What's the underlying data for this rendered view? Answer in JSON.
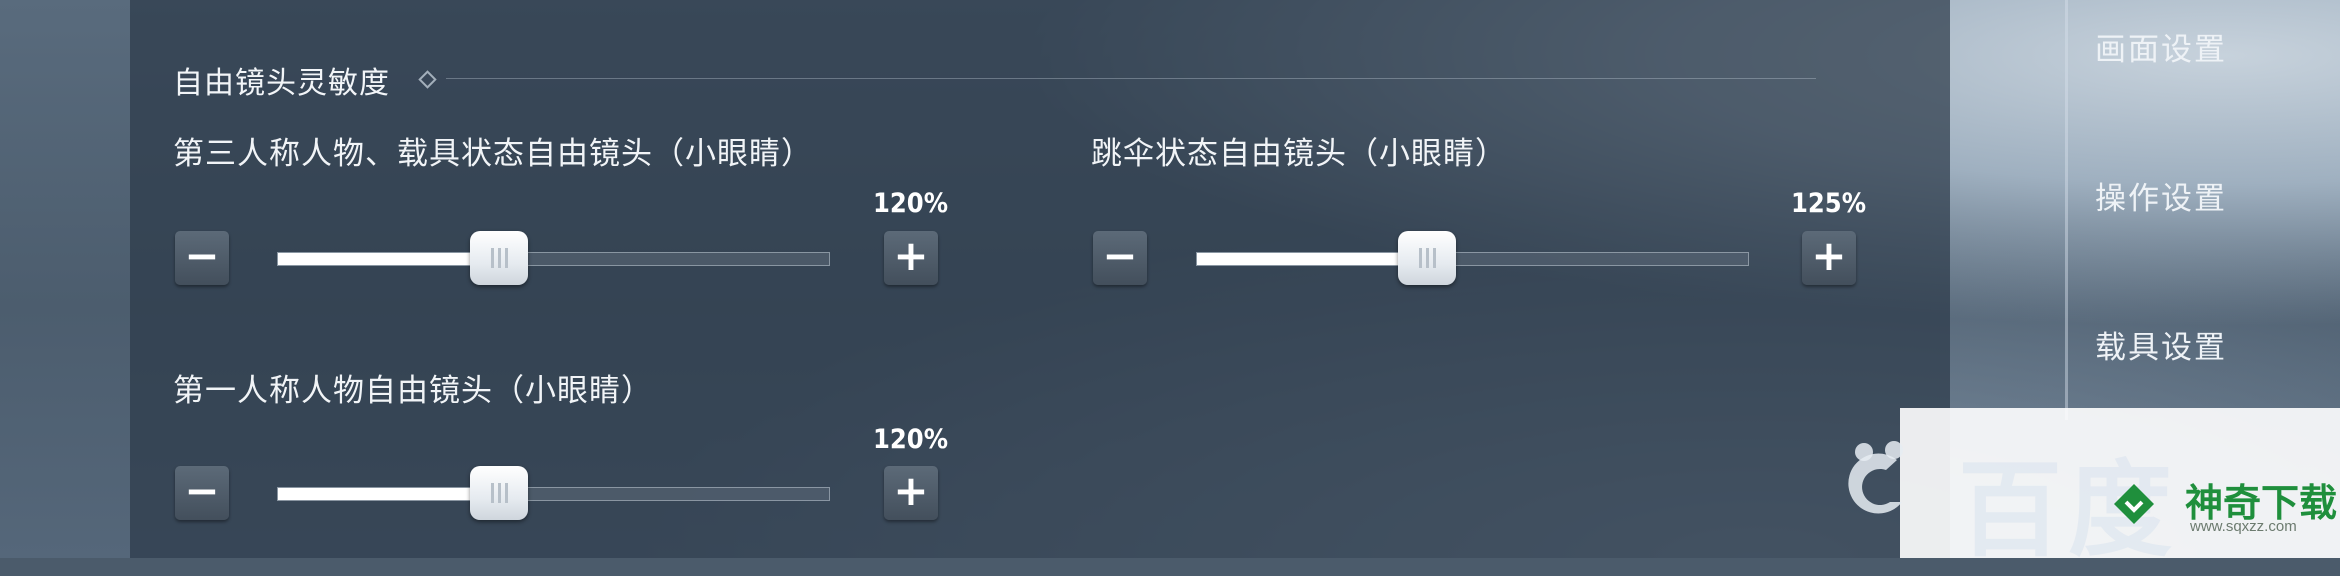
{
  "section": {
    "title": "自由镜头灵敏度"
  },
  "sidebar": {
    "items": [
      {
        "label": "画面设置"
      },
      {
        "label": "操作设置"
      },
      {
        "label": "载具设置"
      }
    ]
  },
  "sliders": [
    {
      "label": "第三人称人物、载具状态自由镜头（小眼睛）",
      "value_text": "120%",
      "value": 120
    },
    {
      "label": "跳伞状态自由镜头（小眼睛）",
      "value_text": "125%",
      "value": 125
    },
    {
      "label": "第一人称人物自由镜头（小眼睛）",
      "value_text": "120%",
      "value": 120
    }
  ],
  "buttons": {
    "minus": "−",
    "plus": "+"
  },
  "watermark": {
    "text": "百度",
    "brand": "神奇下载",
    "url": "www.sqxzz.com"
  },
  "icons": [
    "minus-icon",
    "plus-icon",
    "diamond-icon",
    "slider-grip-icon",
    "watermark-logo-icon"
  ]
}
